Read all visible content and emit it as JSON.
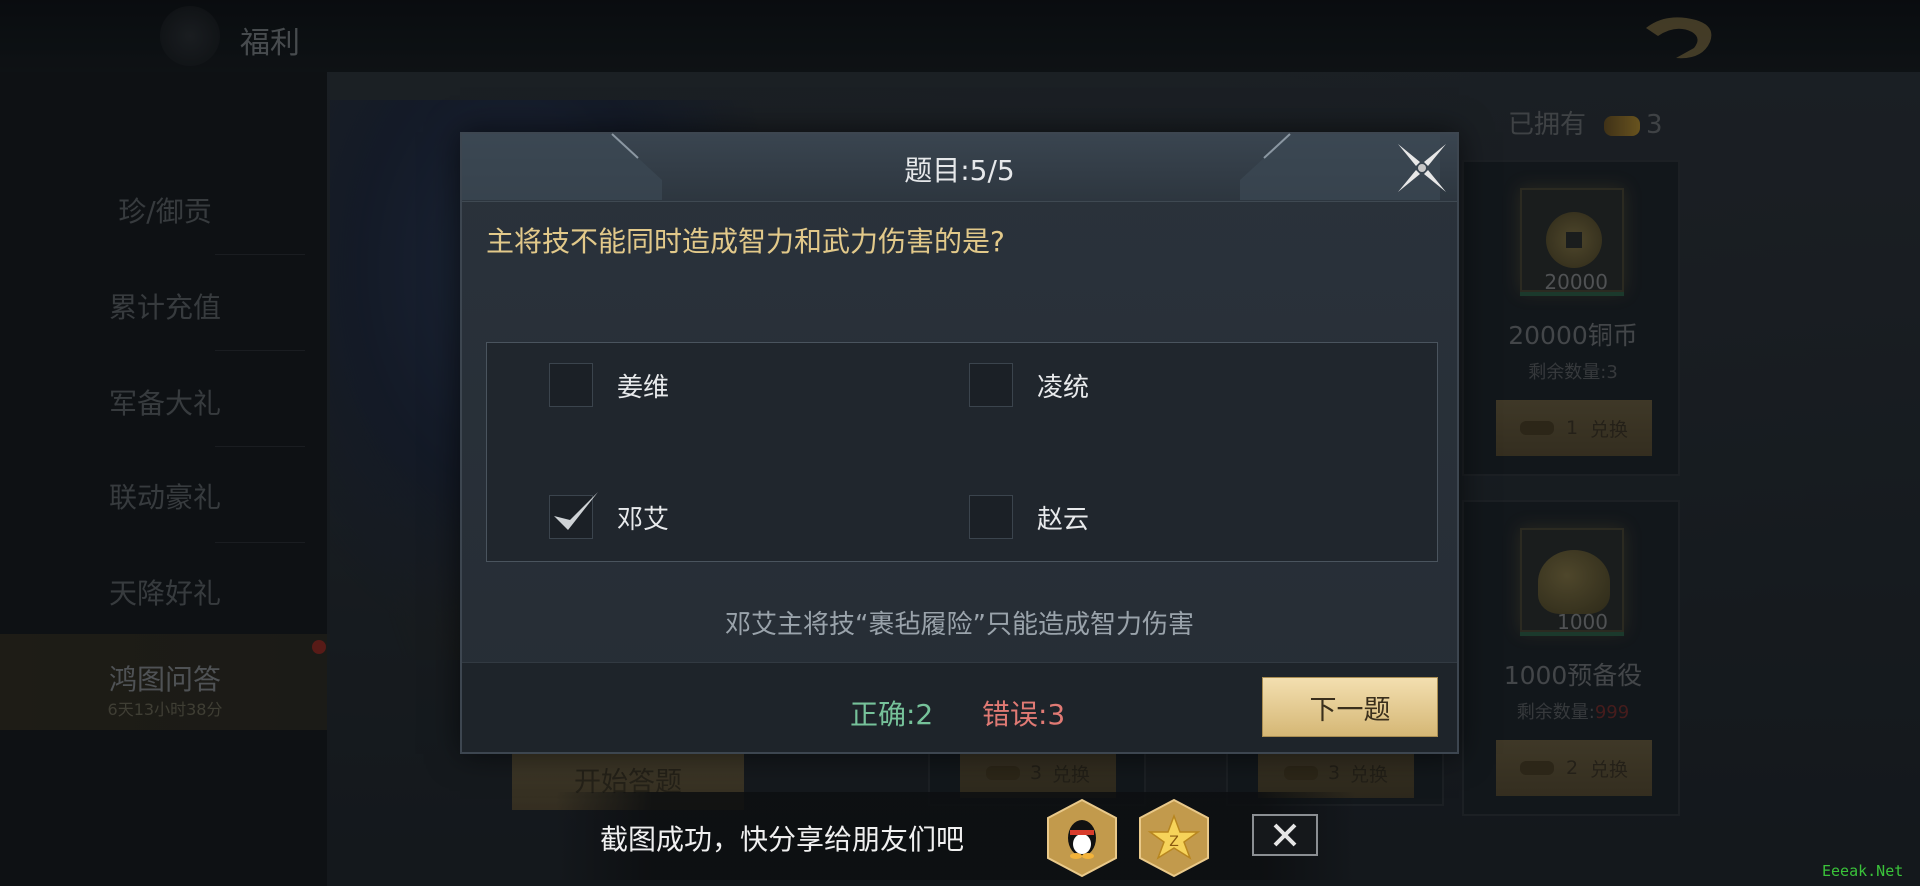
{
  "topbar": {
    "title": "福利"
  },
  "sidebar": {
    "items": [
      {
        "label": "珍/御贡"
      },
      {
        "label": "累计充值"
      },
      {
        "label": "军备大礼"
      },
      {
        "label": "联动豪礼"
      },
      {
        "label": "天降好礼"
      },
      {
        "label": "鸿图问答",
        "sub": "6天13小时38分",
        "active": true
      }
    ]
  },
  "shop": {
    "owned_label": "已拥有",
    "owned_count": "3",
    "rewards": [
      {
        "qty": "20000",
        "name": "20000铜币",
        "remain_label": "剩余数量:",
        "remain_value": "3",
        "cost": "1",
        "button": "兑换",
        "icon": "copper-coin-icon"
      },
      {
        "qty": "1000",
        "name": "1000预备役",
        "remain_label": "剩余数量:",
        "remain_value": "999",
        "cost": "2",
        "button": "兑换",
        "icon": "helmet-icon"
      }
    ],
    "bottom_buttons": [
      {
        "cost": "3",
        "label": "兑换"
      },
      {
        "cost": "3",
        "label": "兑换"
      }
    ],
    "start_label": "开始答题"
  },
  "quiz": {
    "title": "题目:5/5",
    "question": "主将技不能同时造成智力和武力伤害的是?",
    "options": [
      {
        "label": "姜维",
        "checked": false
      },
      {
        "label": "凌统",
        "checked": false
      },
      {
        "label": "邓艾",
        "checked": true
      },
      {
        "label": "赵云",
        "checked": false
      }
    ],
    "explanation": "邓艾主将技“裹毡履险”只能造成智力伤害",
    "correct_label": "正确:2",
    "wrong_label": "错误:3",
    "next_label": "下一题"
  },
  "share": {
    "text": "截图成功，快分享给朋友们吧",
    "qq_icon": "qq-penguin-icon",
    "qzone_icon": "qzone-star-icon",
    "close_icon": "close-icon"
  },
  "watermark": "Eeeak.Net",
  "colors": {
    "question": "#e2c98a",
    "correct": "#76c29a",
    "wrong": "#e07a74",
    "next_button": "#e7cf95"
  }
}
